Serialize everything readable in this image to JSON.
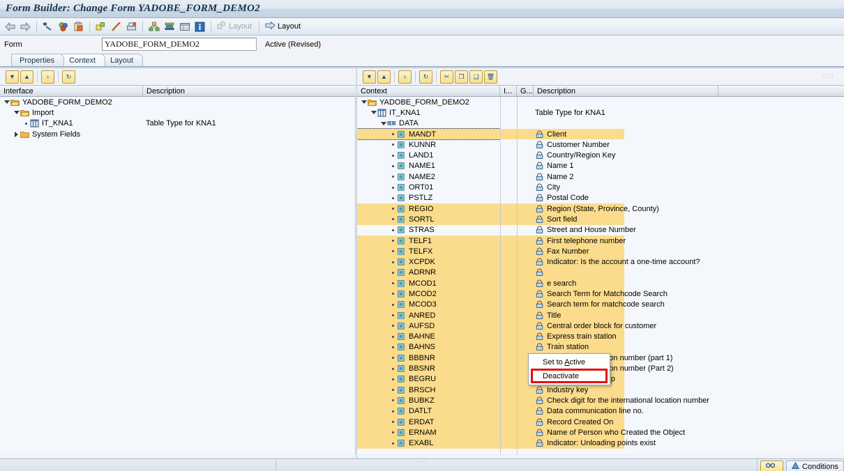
{
  "window": {
    "title": "Form Builder: Change Form YADOBE_FORM_DEMO2"
  },
  "toolbar": {
    "buttons": [
      {
        "name": "back-icon",
        "glyph": "⇦"
      },
      {
        "name": "forward-icon",
        "glyph": "⇨"
      },
      {
        "name": "check-syntax-icon",
        "glyph": "⎇"
      },
      {
        "name": "activate-icon",
        "glyph": "●"
      },
      {
        "name": "paste-clipboard-icon",
        "glyph": "▣"
      },
      {
        "name": "pattern-icon",
        "glyph": "◰"
      },
      {
        "name": "wizard-icon",
        "glyph": "✨"
      },
      {
        "name": "display-object-icon",
        "glyph": "▤"
      },
      {
        "name": "hierarchy-icon",
        "glyph": "⛗"
      },
      {
        "name": "stack-icon",
        "glyph": "≡"
      },
      {
        "name": "table-icon",
        "glyph": "▦"
      },
      {
        "name": "information-icon",
        "glyph": "i"
      }
    ],
    "layout_disabled_label": "Layout",
    "layout_label": "Layout"
  },
  "form": {
    "label": "Form",
    "value": "YADOBE_FORM_DEMO2",
    "placeholder": "",
    "status": "Active (Revised)"
  },
  "tabs": [
    {
      "label": "Properties",
      "active": false
    },
    {
      "label": "Context",
      "active": true
    },
    {
      "label": "Layout",
      "active": false
    }
  ],
  "left_panel": {
    "toolbar": [
      {
        "name": "expand-all-icon",
        "glyph": "▼"
      },
      {
        "name": "collapse-all-icon",
        "glyph": "▲"
      },
      {
        "name": "find-icon",
        "glyph": "♁"
      },
      {
        "name": "refresh-icon",
        "glyph": "↻"
      }
    ],
    "columns": [
      "Interface",
      "Description"
    ],
    "rows": [
      {
        "indent": 0,
        "twisty": "open",
        "icon": "folder-open-icon",
        "label": "YADOBE_FORM_DEMO2",
        "description": ""
      },
      {
        "indent": 1,
        "twisty": "open",
        "icon": "folder-open-icon",
        "label": "Import",
        "description": ""
      },
      {
        "indent": 2,
        "twisty": "leaf",
        "icon": "table-type-icon",
        "label": "IT_KNA1",
        "description": "Table Type for KNA1"
      },
      {
        "indent": 1,
        "twisty": "closed",
        "icon": "folder-closed-icon",
        "label": "System Fields",
        "description": ""
      }
    ]
  },
  "right_panel": {
    "toolbar": [
      {
        "name": "expand-all-icon",
        "glyph": "▼"
      },
      {
        "name": "collapse-all-icon",
        "glyph": "▲"
      },
      {
        "name": "find-icon",
        "glyph": "♁"
      },
      {
        "name": "refresh-icon",
        "glyph": "↻"
      },
      {
        "name": "cut-icon",
        "glyph": "✂"
      },
      {
        "name": "copy-icon",
        "glyph": "❐"
      },
      {
        "name": "paste-icon",
        "glyph": "❑"
      },
      {
        "name": "delete-icon",
        "glyph": "🗑"
      }
    ],
    "columns": [
      "Context",
      "I...",
      "G...",
      "Description"
    ],
    "rows": [
      {
        "indent": 0,
        "twisty": "open",
        "icon": "folder-open-icon",
        "label": "YADOBE_FORM_DEMO2",
        "description": "",
        "lock": false,
        "hl": false,
        "sel": false
      },
      {
        "indent": 1,
        "twisty": "open",
        "icon": "table-type-icon",
        "label": "IT_KNA1",
        "description": "Table Type for KNA1",
        "lock": false,
        "hl": false,
        "sel": false
      },
      {
        "indent": 2,
        "twisty": "open",
        "icon": "structure-icon",
        "label": "DATA",
        "description": "",
        "lock": false,
        "hl": false,
        "sel": false
      },
      {
        "indent": 3,
        "twisty": "leaf",
        "icon": "field-icon",
        "label": "MANDT",
        "description": "Client",
        "lock": true,
        "hl": true,
        "sel": true
      },
      {
        "indent": 3,
        "twisty": "leaf",
        "icon": "field-icon",
        "label": "KUNNR",
        "description": "Customer Number",
        "lock": true,
        "hl": false,
        "sel": false
      },
      {
        "indent": 3,
        "twisty": "leaf",
        "icon": "field-icon",
        "label": "LAND1",
        "description": "Country/Region Key",
        "lock": true,
        "hl": false,
        "sel": false
      },
      {
        "indent": 3,
        "twisty": "leaf",
        "icon": "field-icon",
        "label": "NAME1",
        "description": "Name 1",
        "lock": true,
        "hl": false,
        "sel": false
      },
      {
        "indent": 3,
        "twisty": "leaf",
        "icon": "field-icon",
        "label": "NAME2",
        "description": "Name 2",
        "lock": true,
        "hl": false,
        "sel": false
      },
      {
        "indent": 3,
        "twisty": "leaf",
        "icon": "field-icon",
        "label": "ORT01",
        "description": "City",
        "lock": true,
        "hl": false,
        "sel": false
      },
      {
        "indent": 3,
        "twisty": "leaf",
        "icon": "field-icon",
        "label": "PSTLZ",
        "description": "Postal Code",
        "lock": true,
        "hl": false,
        "sel": false
      },
      {
        "indent": 3,
        "twisty": "leaf",
        "icon": "field-icon",
        "label": "REGIO",
        "description": "Region (State, Province, County)",
        "lock": true,
        "hl": true,
        "sel": false
      },
      {
        "indent": 3,
        "twisty": "leaf",
        "icon": "field-icon",
        "label": "SORTL",
        "description": "Sort field",
        "lock": true,
        "hl": true,
        "sel": false
      },
      {
        "indent": 3,
        "twisty": "leaf",
        "icon": "field-icon",
        "label": "STRAS",
        "description": "Street and House Number",
        "lock": true,
        "hl": false,
        "sel": false
      },
      {
        "indent": 3,
        "twisty": "leaf",
        "icon": "field-icon",
        "label": "TELF1",
        "description": "First telephone number",
        "lock": true,
        "hl": true,
        "sel": false
      },
      {
        "indent": 3,
        "twisty": "leaf",
        "icon": "field-icon",
        "label": "TELFX",
        "description": "Fax Number",
        "lock": true,
        "hl": true,
        "sel": false
      },
      {
        "indent": 3,
        "twisty": "leaf",
        "icon": "field-icon",
        "label": "XCPDK",
        "description": "Indicator: Is the account a one-time account?",
        "lock": true,
        "hl": true,
        "sel": false
      },
      {
        "indent": 3,
        "twisty": "leaf",
        "icon": "field-icon",
        "label": "ADRNR",
        "description": "",
        "lock": true,
        "hl": true,
        "sel": false
      },
      {
        "indent": 3,
        "twisty": "leaf",
        "icon": "field-icon",
        "label": "MCOD1",
        "description": "e search",
        "lock": true,
        "hl": true,
        "sel": false
      },
      {
        "indent": 3,
        "twisty": "leaf",
        "icon": "field-icon",
        "label": "MCOD2",
        "description": "Search Term for Matchcode Search",
        "lock": true,
        "hl": true,
        "sel": false
      },
      {
        "indent": 3,
        "twisty": "leaf",
        "icon": "field-icon",
        "label": "MCOD3",
        "description": "Search term for matchcode search",
        "lock": true,
        "hl": true,
        "sel": false
      },
      {
        "indent": 3,
        "twisty": "leaf",
        "icon": "field-icon",
        "label": "ANRED",
        "description": "Title",
        "lock": true,
        "hl": true,
        "sel": false
      },
      {
        "indent": 3,
        "twisty": "leaf",
        "icon": "field-icon",
        "label": "AUFSD",
        "description": "Central order block for customer",
        "lock": true,
        "hl": true,
        "sel": false
      },
      {
        "indent": 3,
        "twisty": "leaf",
        "icon": "field-icon",
        "label": "BAHNE",
        "description": "Express train station",
        "lock": true,
        "hl": true,
        "sel": false
      },
      {
        "indent": 3,
        "twisty": "leaf",
        "icon": "field-icon",
        "label": "BAHNS",
        "description": "Train station",
        "lock": true,
        "hl": true,
        "sel": false
      },
      {
        "indent": 3,
        "twisty": "leaf",
        "icon": "field-icon",
        "label": "BBBNR",
        "description": "International location number  (part 1)",
        "lock": true,
        "hl": true,
        "sel": false
      },
      {
        "indent": 3,
        "twisty": "leaf",
        "icon": "field-icon",
        "label": "BBSNR",
        "description": "International location number (Part 2)",
        "lock": true,
        "hl": true,
        "sel": false
      },
      {
        "indent": 3,
        "twisty": "leaf",
        "icon": "field-icon",
        "label": "BEGRU",
        "description": "Authorization Group",
        "lock": true,
        "hl": true,
        "sel": false
      },
      {
        "indent": 3,
        "twisty": "leaf",
        "icon": "field-icon",
        "label": "BRSCH",
        "description": "Industry key",
        "lock": true,
        "hl": true,
        "sel": false
      },
      {
        "indent": 3,
        "twisty": "leaf",
        "icon": "field-icon",
        "label": "BUBKZ",
        "description": "Check digit for the international location number",
        "lock": true,
        "hl": true,
        "sel": false
      },
      {
        "indent": 3,
        "twisty": "leaf",
        "icon": "field-icon",
        "label": "DATLT",
        "description": "Data communication line no.",
        "lock": true,
        "hl": true,
        "sel": false
      },
      {
        "indent": 3,
        "twisty": "leaf",
        "icon": "field-icon",
        "label": "ERDAT",
        "description": "Record Created On",
        "lock": true,
        "hl": true,
        "sel": false
      },
      {
        "indent": 3,
        "twisty": "leaf",
        "icon": "field-icon",
        "label": "ERNAM",
        "description": "Name of Person who Created the Object",
        "lock": true,
        "hl": true,
        "sel": false
      },
      {
        "indent": 3,
        "twisty": "leaf",
        "icon": "field-icon",
        "label": "EXABL",
        "description": "Indicator: Unloading points exist",
        "lock": true,
        "hl": true,
        "sel": false
      }
    ]
  },
  "context_menu": {
    "items": [
      {
        "label": "Set to Active",
        "boxed": false
      },
      {
        "label": "Deactivate",
        "boxed": true
      }
    ]
  },
  "bottom_bar": {
    "buttons": [
      {
        "name": "display-change-button",
        "label": "",
        "icon": "glasses-icon"
      },
      {
        "name": "conditions-button",
        "label": "Conditions",
        "icon": "conditions-icon"
      }
    ]
  },
  "colors": {
    "highlight_row": "#fbdc8c",
    "menu_box_border": "#e50f0f",
    "title_text": "#16324e"
  }
}
